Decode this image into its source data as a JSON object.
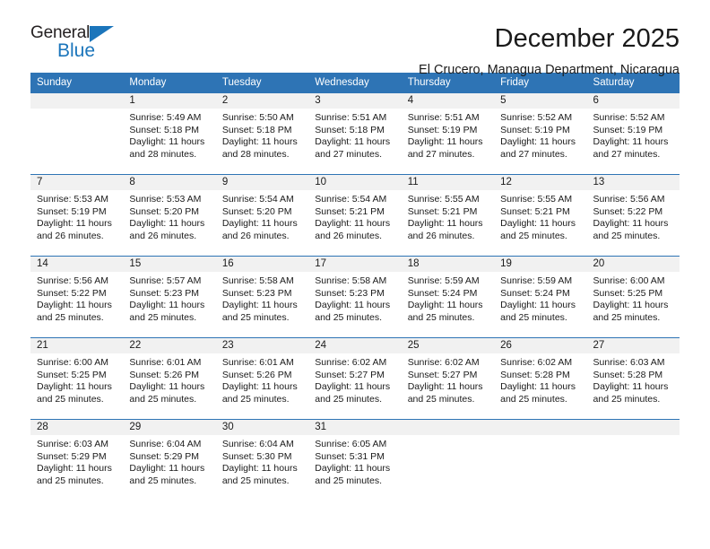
{
  "brand": {
    "name_part1": "General",
    "name_part2": "Blue",
    "accent_color": "#1b75bb"
  },
  "header": {
    "title": "December 2025",
    "location": "El Crucero, Managua Department, Nicaragua"
  },
  "calendar": {
    "header_color": "#2e74b5",
    "weekdays": [
      "Sunday",
      "Monday",
      "Tuesday",
      "Wednesday",
      "Thursday",
      "Friday",
      "Saturday"
    ],
    "weeks": [
      [
        {
          "day": "",
          "sunrise": "",
          "sunset": "",
          "daylight1": "",
          "daylight2": ""
        },
        {
          "day": "1",
          "sunrise": "Sunrise: 5:49 AM",
          "sunset": "Sunset: 5:18 PM",
          "daylight1": "Daylight: 11 hours",
          "daylight2": "and 28 minutes."
        },
        {
          "day": "2",
          "sunrise": "Sunrise: 5:50 AM",
          "sunset": "Sunset: 5:18 PM",
          "daylight1": "Daylight: 11 hours",
          "daylight2": "and 28 minutes."
        },
        {
          "day": "3",
          "sunrise": "Sunrise: 5:51 AM",
          "sunset": "Sunset: 5:18 PM",
          "daylight1": "Daylight: 11 hours",
          "daylight2": "and 27 minutes."
        },
        {
          "day": "4",
          "sunrise": "Sunrise: 5:51 AM",
          "sunset": "Sunset: 5:19 PM",
          "daylight1": "Daylight: 11 hours",
          "daylight2": "and 27 minutes."
        },
        {
          "day": "5",
          "sunrise": "Sunrise: 5:52 AM",
          "sunset": "Sunset: 5:19 PM",
          "daylight1": "Daylight: 11 hours",
          "daylight2": "and 27 minutes."
        },
        {
          "day": "6",
          "sunrise": "Sunrise: 5:52 AM",
          "sunset": "Sunset: 5:19 PM",
          "daylight1": "Daylight: 11 hours",
          "daylight2": "and 27 minutes."
        }
      ],
      [
        {
          "day": "7",
          "sunrise": "Sunrise: 5:53 AM",
          "sunset": "Sunset: 5:19 PM",
          "daylight1": "Daylight: 11 hours",
          "daylight2": "and 26 minutes."
        },
        {
          "day": "8",
          "sunrise": "Sunrise: 5:53 AM",
          "sunset": "Sunset: 5:20 PM",
          "daylight1": "Daylight: 11 hours",
          "daylight2": "and 26 minutes."
        },
        {
          "day": "9",
          "sunrise": "Sunrise: 5:54 AM",
          "sunset": "Sunset: 5:20 PM",
          "daylight1": "Daylight: 11 hours",
          "daylight2": "and 26 minutes."
        },
        {
          "day": "10",
          "sunrise": "Sunrise: 5:54 AM",
          "sunset": "Sunset: 5:21 PM",
          "daylight1": "Daylight: 11 hours",
          "daylight2": "and 26 minutes."
        },
        {
          "day": "11",
          "sunrise": "Sunrise: 5:55 AM",
          "sunset": "Sunset: 5:21 PM",
          "daylight1": "Daylight: 11 hours",
          "daylight2": "and 26 minutes."
        },
        {
          "day": "12",
          "sunrise": "Sunrise: 5:55 AM",
          "sunset": "Sunset: 5:21 PM",
          "daylight1": "Daylight: 11 hours",
          "daylight2": "and 25 minutes."
        },
        {
          "day": "13",
          "sunrise": "Sunrise: 5:56 AM",
          "sunset": "Sunset: 5:22 PM",
          "daylight1": "Daylight: 11 hours",
          "daylight2": "and 25 minutes."
        }
      ],
      [
        {
          "day": "14",
          "sunrise": "Sunrise: 5:56 AM",
          "sunset": "Sunset: 5:22 PM",
          "daylight1": "Daylight: 11 hours",
          "daylight2": "and 25 minutes."
        },
        {
          "day": "15",
          "sunrise": "Sunrise: 5:57 AM",
          "sunset": "Sunset: 5:23 PM",
          "daylight1": "Daylight: 11 hours",
          "daylight2": "and 25 minutes."
        },
        {
          "day": "16",
          "sunrise": "Sunrise: 5:58 AM",
          "sunset": "Sunset: 5:23 PM",
          "daylight1": "Daylight: 11 hours",
          "daylight2": "and 25 minutes."
        },
        {
          "day": "17",
          "sunrise": "Sunrise: 5:58 AM",
          "sunset": "Sunset: 5:23 PM",
          "daylight1": "Daylight: 11 hours",
          "daylight2": "and 25 minutes."
        },
        {
          "day": "18",
          "sunrise": "Sunrise: 5:59 AM",
          "sunset": "Sunset: 5:24 PM",
          "daylight1": "Daylight: 11 hours",
          "daylight2": "and 25 minutes."
        },
        {
          "day": "19",
          "sunrise": "Sunrise: 5:59 AM",
          "sunset": "Sunset: 5:24 PM",
          "daylight1": "Daylight: 11 hours",
          "daylight2": "and 25 minutes."
        },
        {
          "day": "20",
          "sunrise": "Sunrise: 6:00 AM",
          "sunset": "Sunset: 5:25 PM",
          "daylight1": "Daylight: 11 hours",
          "daylight2": "and 25 minutes."
        }
      ],
      [
        {
          "day": "21",
          "sunrise": "Sunrise: 6:00 AM",
          "sunset": "Sunset: 5:25 PM",
          "daylight1": "Daylight: 11 hours",
          "daylight2": "and 25 minutes."
        },
        {
          "day": "22",
          "sunrise": "Sunrise: 6:01 AM",
          "sunset": "Sunset: 5:26 PM",
          "daylight1": "Daylight: 11 hours",
          "daylight2": "and 25 minutes."
        },
        {
          "day": "23",
          "sunrise": "Sunrise: 6:01 AM",
          "sunset": "Sunset: 5:26 PM",
          "daylight1": "Daylight: 11 hours",
          "daylight2": "and 25 minutes."
        },
        {
          "day": "24",
          "sunrise": "Sunrise: 6:02 AM",
          "sunset": "Sunset: 5:27 PM",
          "daylight1": "Daylight: 11 hours",
          "daylight2": "and 25 minutes."
        },
        {
          "day": "25",
          "sunrise": "Sunrise: 6:02 AM",
          "sunset": "Sunset: 5:27 PM",
          "daylight1": "Daylight: 11 hours",
          "daylight2": "and 25 minutes."
        },
        {
          "day": "26",
          "sunrise": "Sunrise: 6:02 AM",
          "sunset": "Sunset: 5:28 PM",
          "daylight1": "Daylight: 11 hours",
          "daylight2": "and 25 minutes."
        },
        {
          "day": "27",
          "sunrise": "Sunrise: 6:03 AM",
          "sunset": "Sunset: 5:28 PM",
          "daylight1": "Daylight: 11 hours",
          "daylight2": "and 25 minutes."
        }
      ],
      [
        {
          "day": "28",
          "sunrise": "Sunrise: 6:03 AM",
          "sunset": "Sunset: 5:29 PM",
          "daylight1": "Daylight: 11 hours",
          "daylight2": "and 25 minutes."
        },
        {
          "day": "29",
          "sunrise": "Sunrise: 6:04 AM",
          "sunset": "Sunset: 5:29 PM",
          "daylight1": "Daylight: 11 hours",
          "daylight2": "and 25 minutes."
        },
        {
          "day": "30",
          "sunrise": "Sunrise: 6:04 AM",
          "sunset": "Sunset: 5:30 PM",
          "daylight1": "Daylight: 11 hours",
          "daylight2": "and 25 minutes."
        },
        {
          "day": "31",
          "sunrise": "Sunrise: 6:05 AM",
          "sunset": "Sunset: 5:31 PM",
          "daylight1": "Daylight: 11 hours",
          "daylight2": "and 25 minutes."
        },
        {
          "day": "",
          "sunrise": "",
          "sunset": "",
          "daylight1": "",
          "daylight2": ""
        },
        {
          "day": "",
          "sunrise": "",
          "sunset": "",
          "daylight1": "",
          "daylight2": ""
        },
        {
          "day": "",
          "sunrise": "",
          "sunset": "",
          "daylight1": "",
          "daylight2": ""
        }
      ]
    ]
  }
}
